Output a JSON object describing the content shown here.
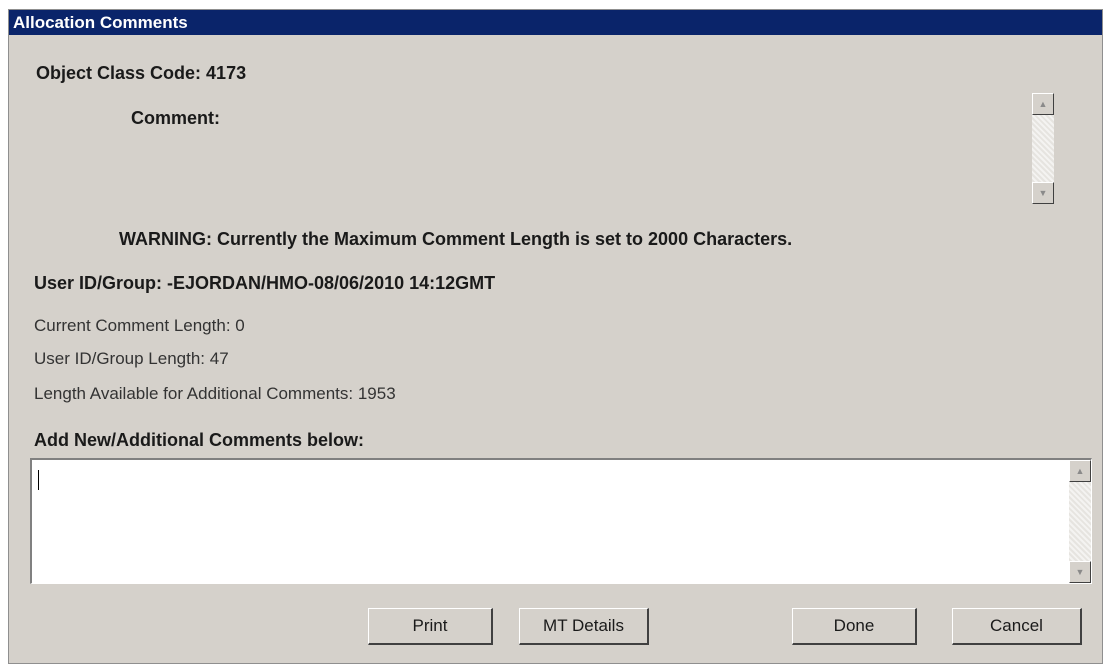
{
  "window": {
    "title": "Allocation Comments"
  },
  "labels": {
    "object_class": "Object Class Code: 4173",
    "comment": "Comment:",
    "warning": "WARNING: Currently the Maximum Comment Length is set to 2000 Characters.",
    "user_id_group": "User ID/Group: -EJORDAN/HMO-08/06/2010 14:12GMT",
    "current_comment_length": "Current Comment Length: 0",
    "user_id_group_length": "User ID/Group Length: 47",
    "length_available": "Length Available for Additional Comments: 1953",
    "add_new": "Add New/Additional Comments below:"
  },
  "comment_display": {
    "value": ""
  },
  "new_comment": {
    "value": ""
  },
  "buttons": {
    "print": "Print",
    "mt_details": "MT Details",
    "done": "Done",
    "cancel": "Cancel"
  },
  "icons": {
    "scroll_up": "scroll-up-arrow",
    "scroll_down": "scroll-down-arrow"
  },
  "colors": {
    "titlebar": "#0a246a",
    "dialog_background": "#d5d1cb"
  }
}
